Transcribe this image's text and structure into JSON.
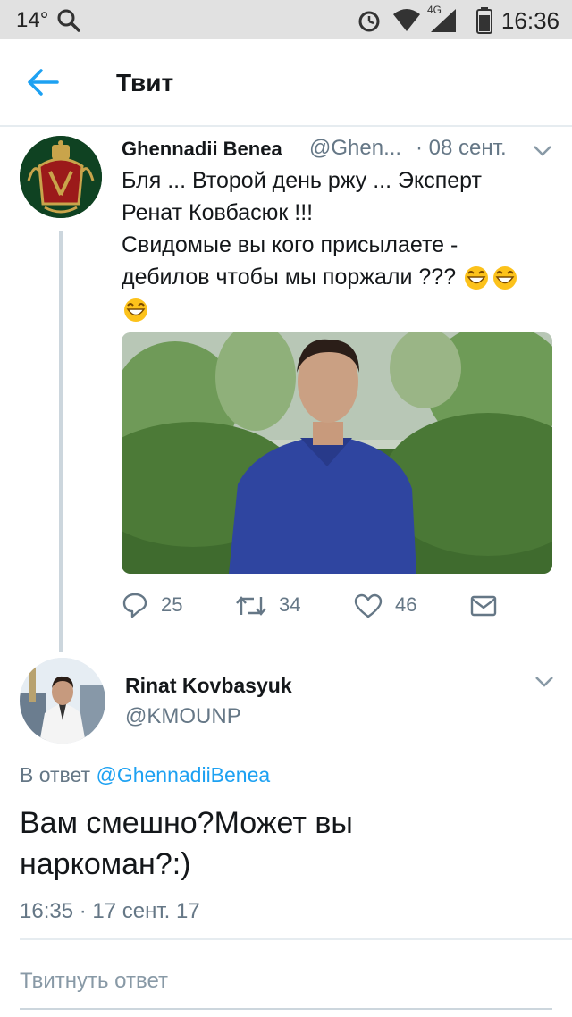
{
  "status_bar": {
    "temperature": "14°",
    "network": "4G",
    "time": "16:36"
  },
  "app_bar": {
    "title": "Твит",
    "back_icon": "arrow-left-icon"
  },
  "parent_tweet": {
    "author_name": "Ghennadii Benea",
    "author_handle": "@Ghen...",
    "date": "· 08 сент.",
    "text_lines": [
      "Бля ... Второй день ржу ... Эксперт",
      "Ренат Ковбасюк !!!",
      "Свидомые вы кого присылаете -",
      "дебилов чтобы мы поржали ???"
    ],
    "emoji": "face-with-tears-of-joy",
    "media": "video-thumbnail",
    "actions": {
      "replies": "25",
      "retweets": "34",
      "likes": "46"
    }
  },
  "main_tweet": {
    "author_name": "Rinat Kovbasyuk",
    "author_handle": "@KMOUNP",
    "reply_prefix": "В ответ",
    "reply_to": "@GhennadiiBenea",
    "text": "Вам смешно?Может вы наркоман?:)",
    "text_lines": [
      "Вам смешно?Может вы",
      "наркоман?:)"
    ],
    "timestamp": "16:35 · 17 сент. 17"
  },
  "reply_box": {
    "placeholder": "Твитнуть ответ"
  },
  "colors": {
    "accent": "#1da1f2",
    "muted": "#657786",
    "statusbar": "#e1e1e1"
  }
}
